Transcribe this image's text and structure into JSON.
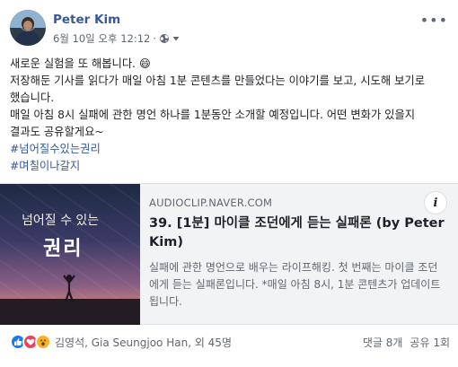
{
  "post": {
    "author": "Peter Kim",
    "timestamp": "6월 10일 오후 12:12",
    "separator": "·",
    "text_lines": [
      "새로운 실험을 또 해봅니다. 😄",
      "저장해둔 기사를 읽다가 매일 아침 1분 콘텐츠를 만들었다는 이야기를 보고, 시도해 보기로",
      "했습니다.",
      "매일 아침 8시 실패에 관한 명언 하나를 1분동안 소개할 예정입니다. 어떤 변화가 있을지",
      "결과도 공유할게요~"
    ],
    "hashtags": [
      "#넘어질수있는권리",
      "#며칠이나갈지"
    ]
  },
  "link_card": {
    "domain": "AUDIOCLIP.NAVER.COM",
    "title": "39. [1분] 마이클 조던에게 듣는 실패론 (by Peter Kim)",
    "description": "실패에 관한 명언으로 배우는 라이프해킹. 첫 번째는 마이클 조던에게 듣는 실패론입니다. *매일 아침 8시, 1분 콘텐츠가 업데이트 됩니다.",
    "thumbnail_line1": "넘어질 수 있는",
    "thumbnail_line2": "권리",
    "info_icon": "i"
  },
  "footer": {
    "reaction_icons": [
      "like-icon",
      "love-icon",
      "wow-icon"
    ],
    "reaction_names": "김영석, Gia Seungjoo Han, 외 45명",
    "comments": "댓글 8개",
    "shares": "공유 1회"
  },
  "colors": {
    "link_blue": "#385898",
    "like": "#1877f2",
    "love": "#f33e58",
    "wow": "#f7b125"
  }
}
